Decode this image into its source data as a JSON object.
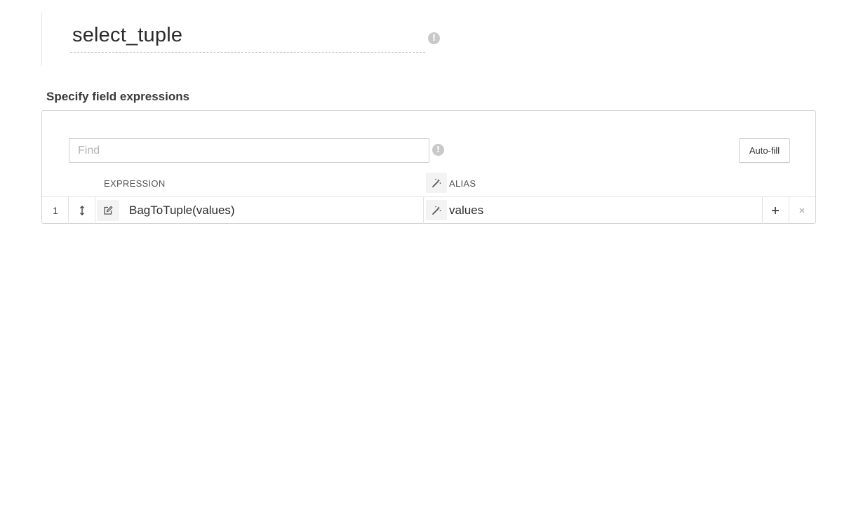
{
  "node": {
    "title": "select_tuple"
  },
  "section": {
    "label": "Specify field expressions"
  },
  "find": {
    "placeholder": "Find",
    "value": ""
  },
  "toolbar": {
    "autofill_label": "Auto-fill"
  },
  "table": {
    "columns": {
      "expression": "EXPRESSION",
      "alias": "ALIAS"
    },
    "rows": [
      {
        "index": "1",
        "expression": "BagToTuple(values)",
        "alias": "values"
      }
    ]
  },
  "icons": {
    "info": "info-icon",
    "drag": "drag-handle-icon",
    "edit": "edit-icon",
    "wand": "magic-wand-icon",
    "add": "plus-icon",
    "remove": "close-icon"
  },
  "colors": {
    "border": "#d4d4d4",
    "icon_grey": "#c9c9c9",
    "text": "#2b2b2b"
  }
}
